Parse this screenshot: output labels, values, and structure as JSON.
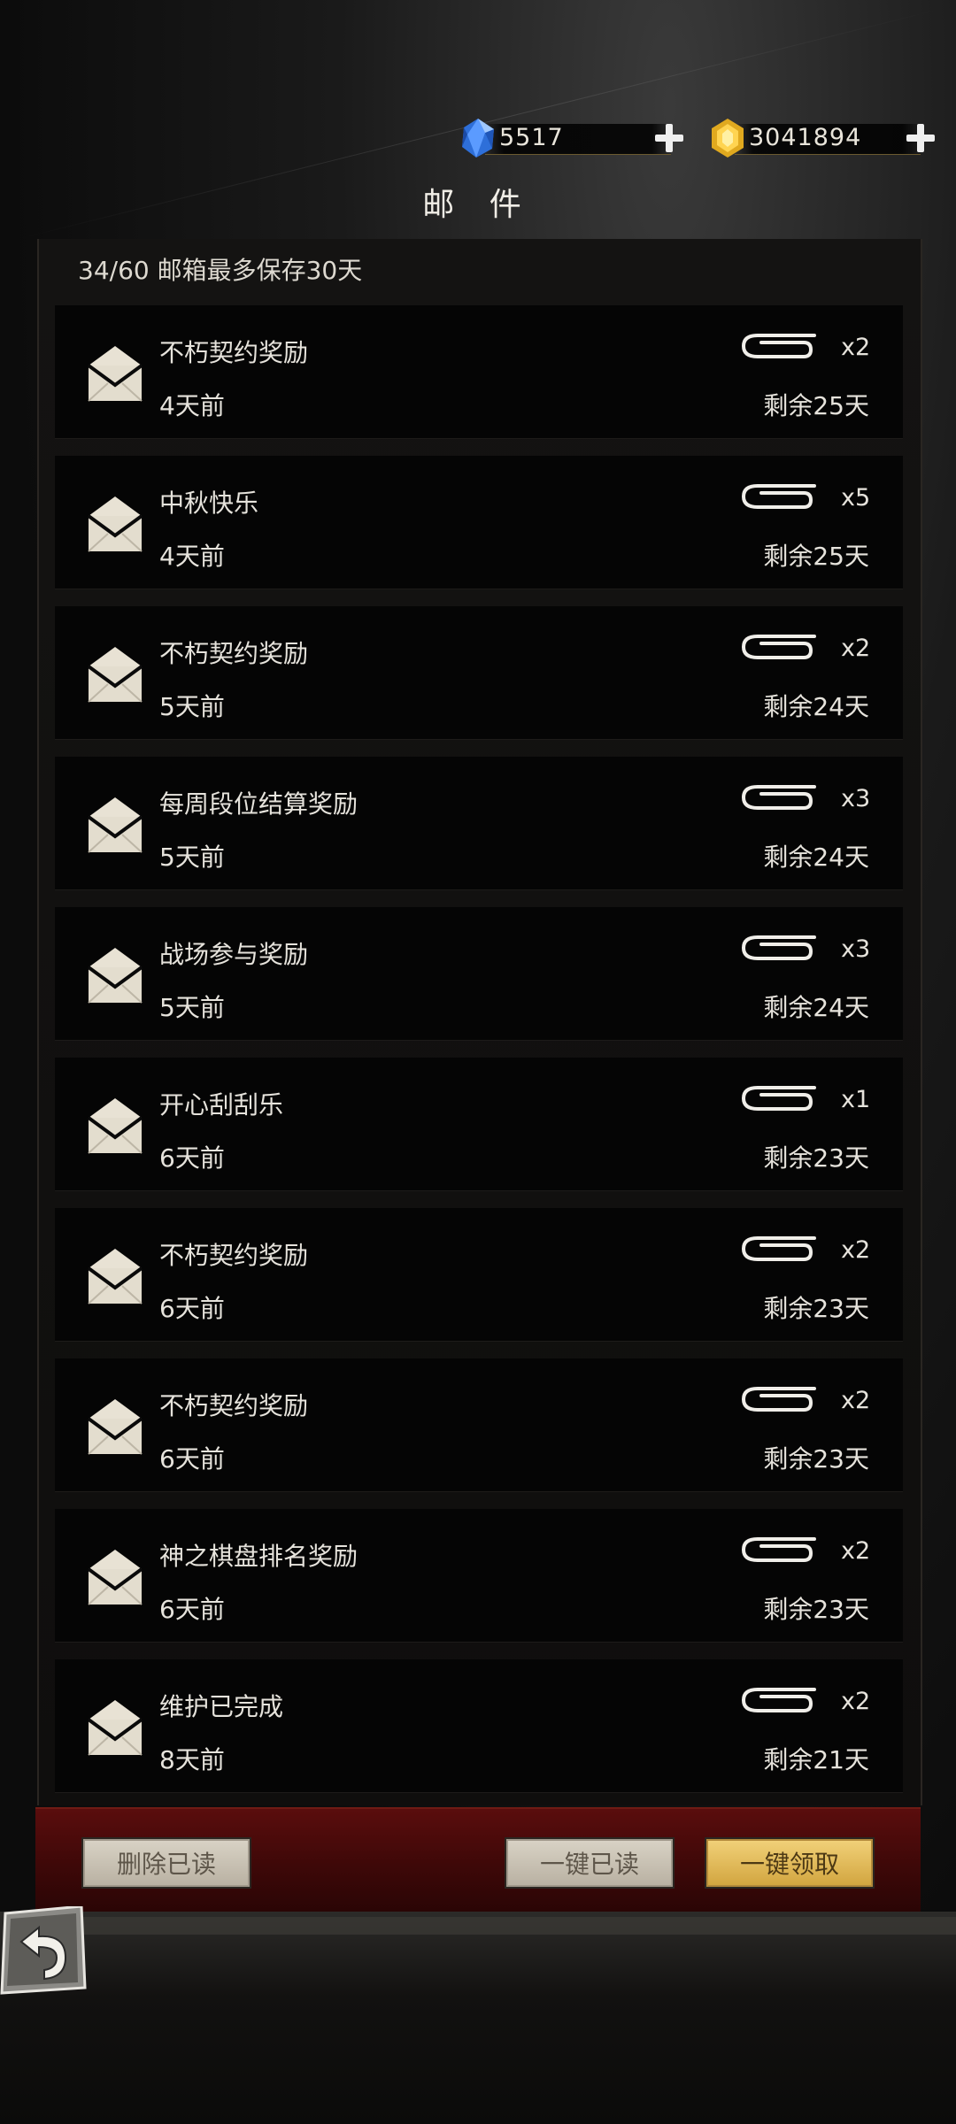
{
  "header": {
    "title": "邮 件",
    "currencies": [
      {
        "name": "diamond",
        "icon": "blue-crystal-icon",
        "value": "5517"
      },
      {
        "name": "gold",
        "icon": "gold-crystal-icon",
        "value": "3041894"
      }
    ]
  },
  "mailbox": {
    "info": "34/60 邮箱最多保存30天"
  },
  "mails": [
    {
      "title": "不朽契约奖励",
      "time": "4天前",
      "count": "x2",
      "remain": "剩余25天"
    },
    {
      "title": "中秋快乐",
      "time": "4天前",
      "count": "x5",
      "remain": "剩余25天"
    },
    {
      "title": "不朽契约奖励",
      "time": "5天前",
      "count": "x2",
      "remain": "剩余24天"
    },
    {
      "title": "每周段位结算奖励",
      "time": "5天前",
      "count": "x3",
      "remain": "剩余24天"
    },
    {
      "title": "战场参与奖励",
      "time": "5天前",
      "count": "x3",
      "remain": "剩余24天"
    },
    {
      "title": "开心刮刮乐",
      "time": "6天前",
      "count": "x1",
      "remain": "剩余23天"
    },
    {
      "title": "不朽契约奖励",
      "time": "6天前",
      "count": "x2",
      "remain": "剩余23天"
    },
    {
      "title": "不朽契约奖励",
      "time": "6天前",
      "count": "x2",
      "remain": "剩余23天"
    },
    {
      "title": "神之棋盘排名奖励",
      "time": "6天前",
      "count": "x2",
      "remain": "剩余23天"
    },
    {
      "title": "维护已完成",
      "time": "8天前",
      "count": "x2",
      "remain": "剩余21天"
    }
  ],
  "actions": {
    "delete_read": "删除已读",
    "mark_all_read": "一键已读",
    "claim_all": "一键领取"
  },
  "colors": {
    "accent_gold": "#d9ac45",
    "bottom_bar_red": "#4a0a0a",
    "list_bg": "#050505"
  }
}
